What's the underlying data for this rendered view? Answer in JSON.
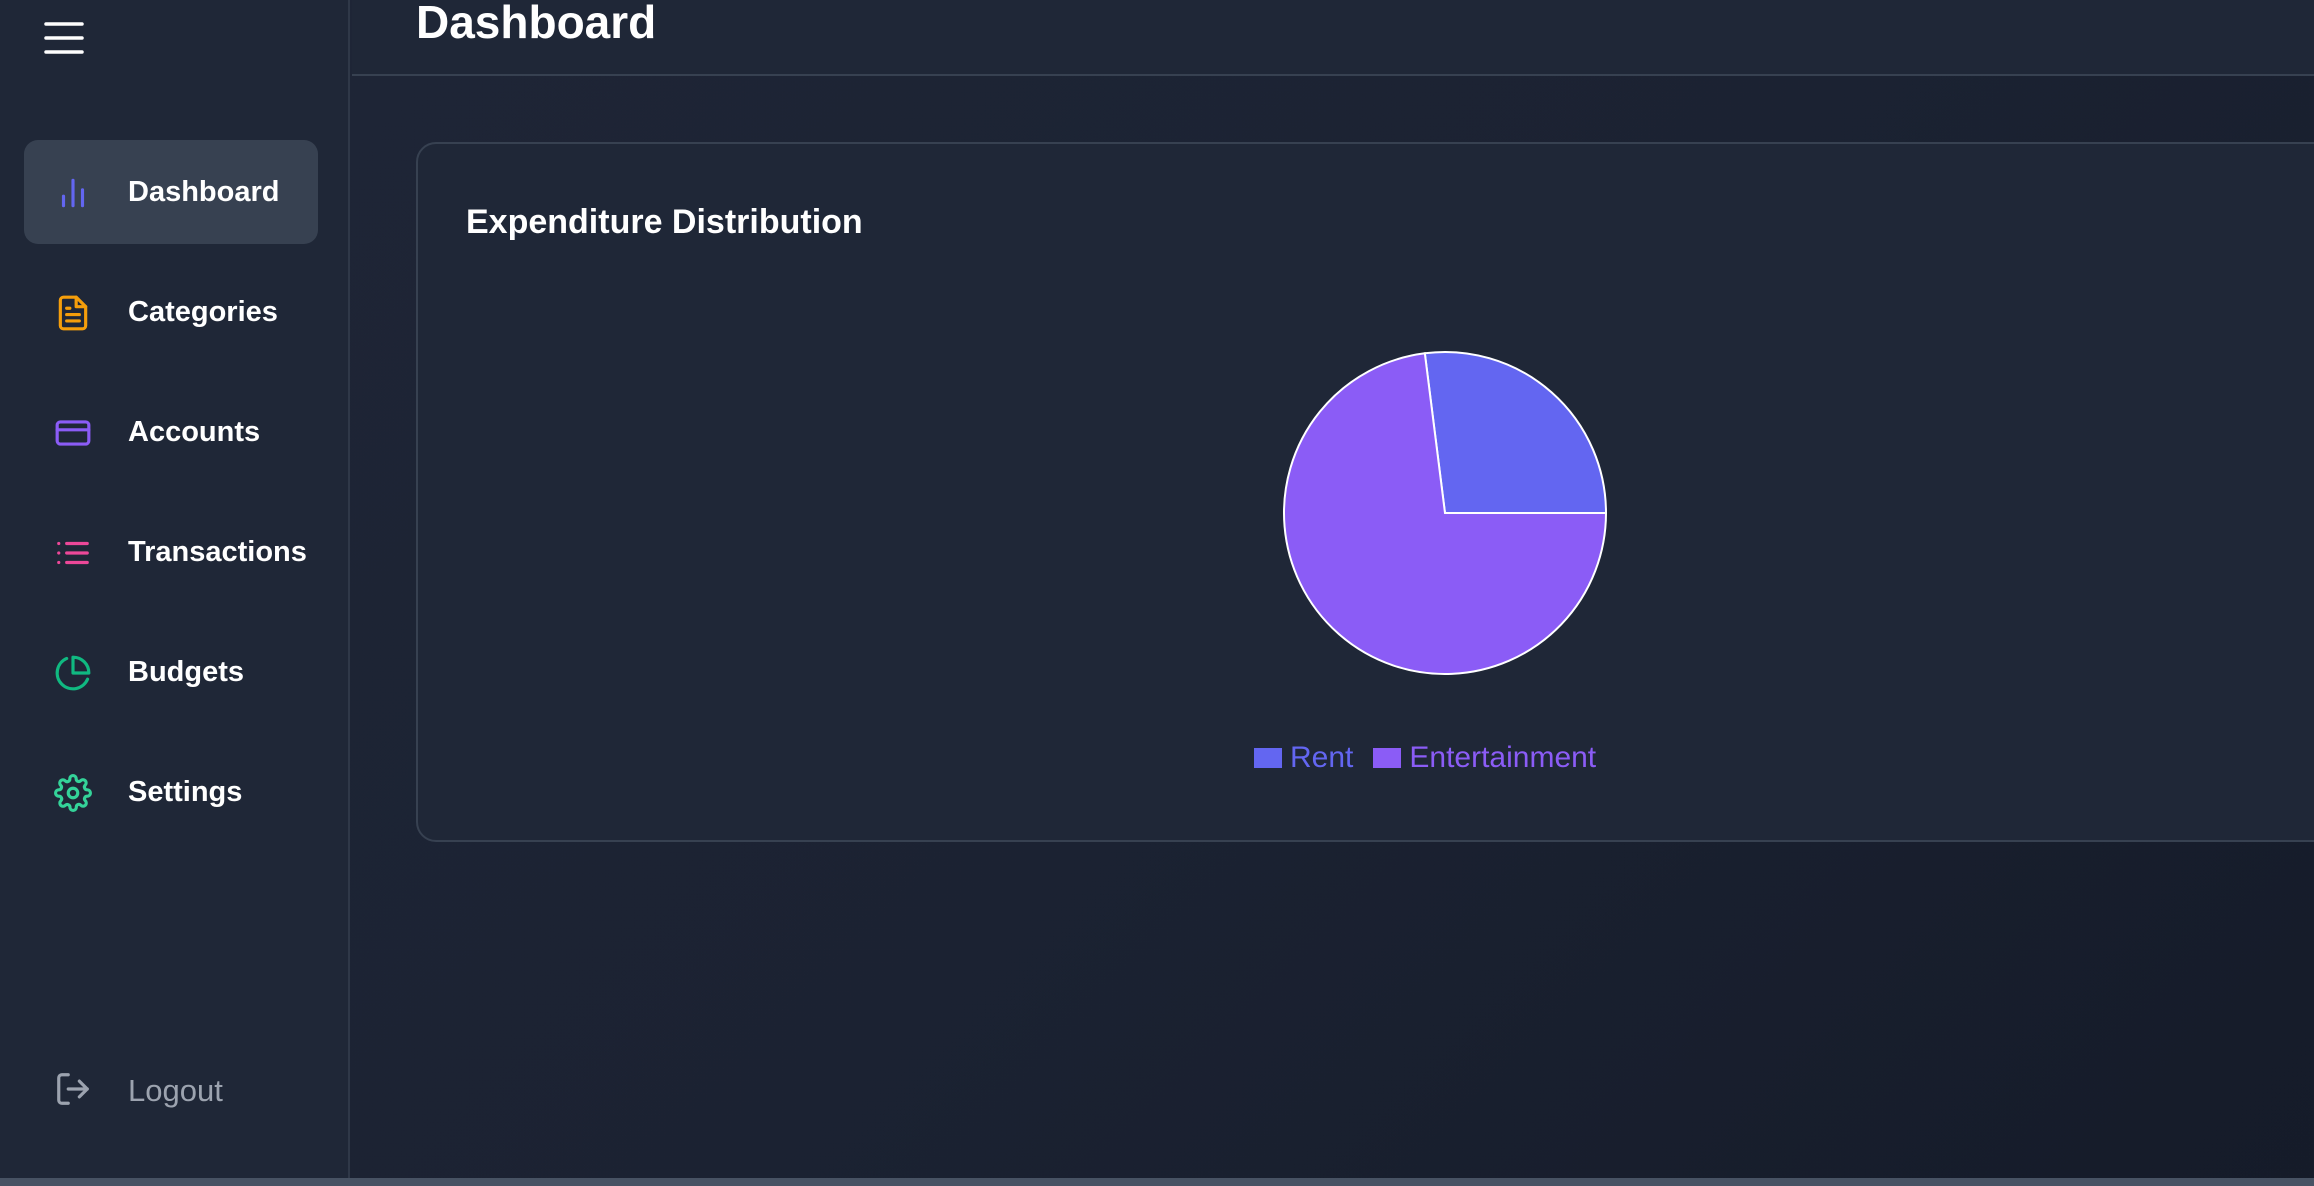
{
  "app": {
    "page_title": "Dashboard"
  },
  "sidebar": {
    "items": [
      {
        "label": "Dashboard",
        "icon": "bar-chart-icon",
        "color": "#6366f1",
        "active": true
      },
      {
        "label": "Categories",
        "icon": "document-icon",
        "color": "#f59e0b",
        "active": false
      },
      {
        "label": "Accounts",
        "icon": "credit-card-icon",
        "color": "#8b5cf6",
        "active": false
      },
      {
        "label": "Transactions",
        "icon": "list-icon",
        "color": "#ec4899",
        "active": false
      },
      {
        "label": "Budgets",
        "icon": "pie-chart-icon",
        "color": "#10b981",
        "active": false
      },
      {
        "label": "Settings",
        "icon": "gear-icon",
        "color": "#34d399",
        "active": false
      }
    ],
    "logout": {
      "label": "Logout",
      "icon": "logout-icon",
      "color": "#9ca3af"
    }
  },
  "card": {
    "title": "Expenditure Distribution"
  },
  "chart_data": {
    "type": "pie",
    "title": "Expenditure Distribution",
    "categories": [
      "Rent",
      "Entertainment"
    ],
    "values": [
      27,
      73
    ],
    "colors": [
      "#6366f1",
      "#8b5cf6"
    ],
    "legend_position": "bottom"
  }
}
